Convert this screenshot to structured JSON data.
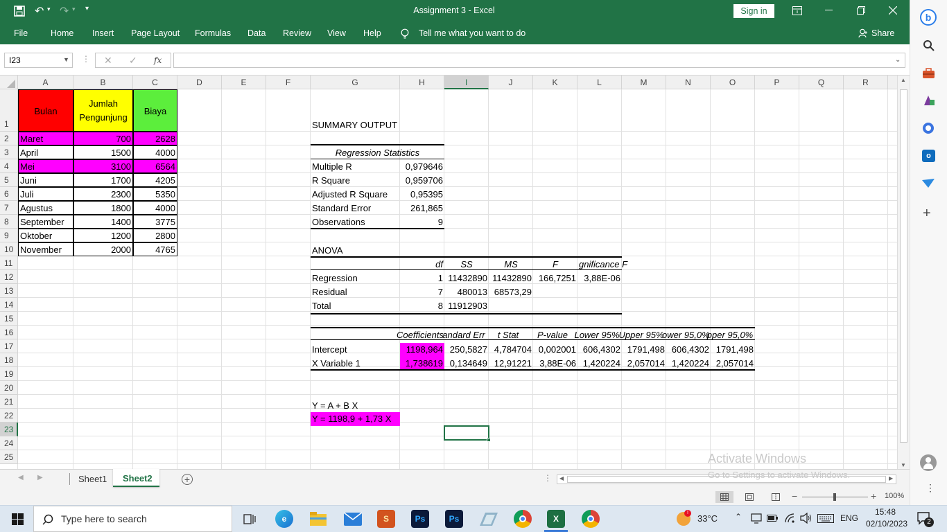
{
  "window": {
    "title": "Assignment 3  -  Excel",
    "sign_in": "Sign in"
  },
  "ribbon": {
    "tabs": [
      "File",
      "Home",
      "Insert",
      "Page Layout",
      "Formulas",
      "Data",
      "Review",
      "View",
      "Help"
    ],
    "tell_me": "Tell me what you want to do",
    "share": "Share"
  },
  "formula_bar": {
    "name_box": "I23",
    "fx": "fx",
    "content": ""
  },
  "grid": {
    "columns": [
      "A",
      "B",
      "C",
      "D",
      "E",
      "F",
      "G",
      "H",
      "I",
      "J",
      "K",
      "L",
      "M",
      "N",
      "O",
      "P",
      "Q",
      "R"
    ],
    "rows": [
      "1",
      "2",
      "3",
      "4",
      "5",
      "6",
      "7",
      "8",
      "9",
      "10",
      "11",
      "12",
      "13",
      "14",
      "15",
      "16",
      "17",
      "18",
      "19",
      "20",
      "21",
      "22",
      "23",
      "24",
      "25"
    ],
    "table_headers": {
      "bulan": "Bulan",
      "pengunjung_1": "Jumlah",
      "pengunjung_2": "Pengunjung",
      "biaya": "Biaya"
    },
    "data_rows": [
      {
        "bulan": "Maret",
        "pengunjung": "700",
        "biaya": "2628"
      },
      {
        "bulan": "April",
        "pengunjung": "1500",
        "biaya": "4000"
      },
      {
        "bulan": "Mei",
        "pengunjung": "3100",
        "biaya": "6564"
      },
      {
        "bulan": "Juni",
        "pengunjung": "1700",
        "biaya": "4205"
      },
      {
        "bulan": "Juli",
        "pengunjung": "2300",
        "biaya": "5350"
      },
      {
        "bulan": "Agustus",
        "pengunjung": "1800",
        "biaya": "4000"
      },
      {
        "bulan": "September",
        "pengunjung": "1400",
        "biaya": "3775"
      },
      {
        "bulan": "Oktober",
        "pengunjung": "1200",
        "biaya": "2800"
      },
      {
        "bulan": "November",
        "pengunjung": "2000",
        "biaya": "4765"
      }
    ],
    "summary_output": "SUMMARY OUTPUT",
    "regression_statistics": {
      "heading": "Regression Statistics",
      "rows": [
        {
          "label": "Multiple R",
          "value": "0,979646"
        },
        {
          "label": "R Square",
          "value": "0,959706"
        },
        {
          "label": "Adjusted R Square",
          "value": "0,95395"
        },
        {
          "label": "Standard Error",
          "value": "261,865"
        },
        {
          "label": "Observations",
          "value": "9"
        }
      ]
    },
    "anova": {
      "heading": "ANOVA",
      "headers": [
        "df",
        "SS",
        "MS",
        "F",
        "gnificance F"
      ],
      "rows": [
        {
          "label": "Regression",
          "values": [
            "1",
            "11432890",
            "11432890",
            "166,7251",
            "3,88E-06"
          ]
        },
        {
          "label": "Residual",
          "values": [
            "7",
            "480013",
            "68573,29",
            "",
            ""
          ]
        },
        {
          "label": "Total",
          "values": [
            "8",
            "11912903",
            "",
            "",
            ""
          ]
        }
      ]
    },
    "coefficients": {
      "headers": [
        "Coefficients",
        "andard Err",
        "t Stat",
        "P-value",
        "Lower 95%",
        "Upper 95%",
        "ower 95,0%",
        "pper 95,0%"
      ],
      "rows": [
        {
          "label": "Intercept",
          "values": [
            "1198,964",
            "250,5827",
            "4,784704",
            "0,002001",
            "606,4302",
            "1791,498",
            "606,4302",
            "1791,498"
          ]
        },
        {
          "label": "X Variable 1",
          "values": [
            "1,738619",
            "0,134649",
            "12,91221",
            "3,88E-06",
            "1,420224",
            "2,057014",
            "1,420224",
            "2,057014"
          ]
        }
      ]
    },
    "equation_general": "Y = A + B X",
    "equation_result": "Y = 1198,9 + 1,73 X"
  },
  "sheet_tabs": [
    "Sheet1",
    "Sheet2"
  ],
  "active_sheet": "Sheet2",
  "status": {
    "zoom": "100%",
    "watermark_title": "Activate Windows",
    "watermark_sub": "Go to Settings to activate Windows."
  },
  "taskbar": {
    "search_placeholder": "Type here to search",
    "temperature": "33°C",
    "language": "ENG",
    "time": "15:48",
    "date": "02/10/2023",
    "notifications": "2"
  },
  "colors": {
    "excel_green": "#217346",
    "red_header": "#ff0000",
    "yellow_header": "#ffff00",
    "green_header": "#5cee3c",
    "magenta": "#ff00ff"
  }
}
